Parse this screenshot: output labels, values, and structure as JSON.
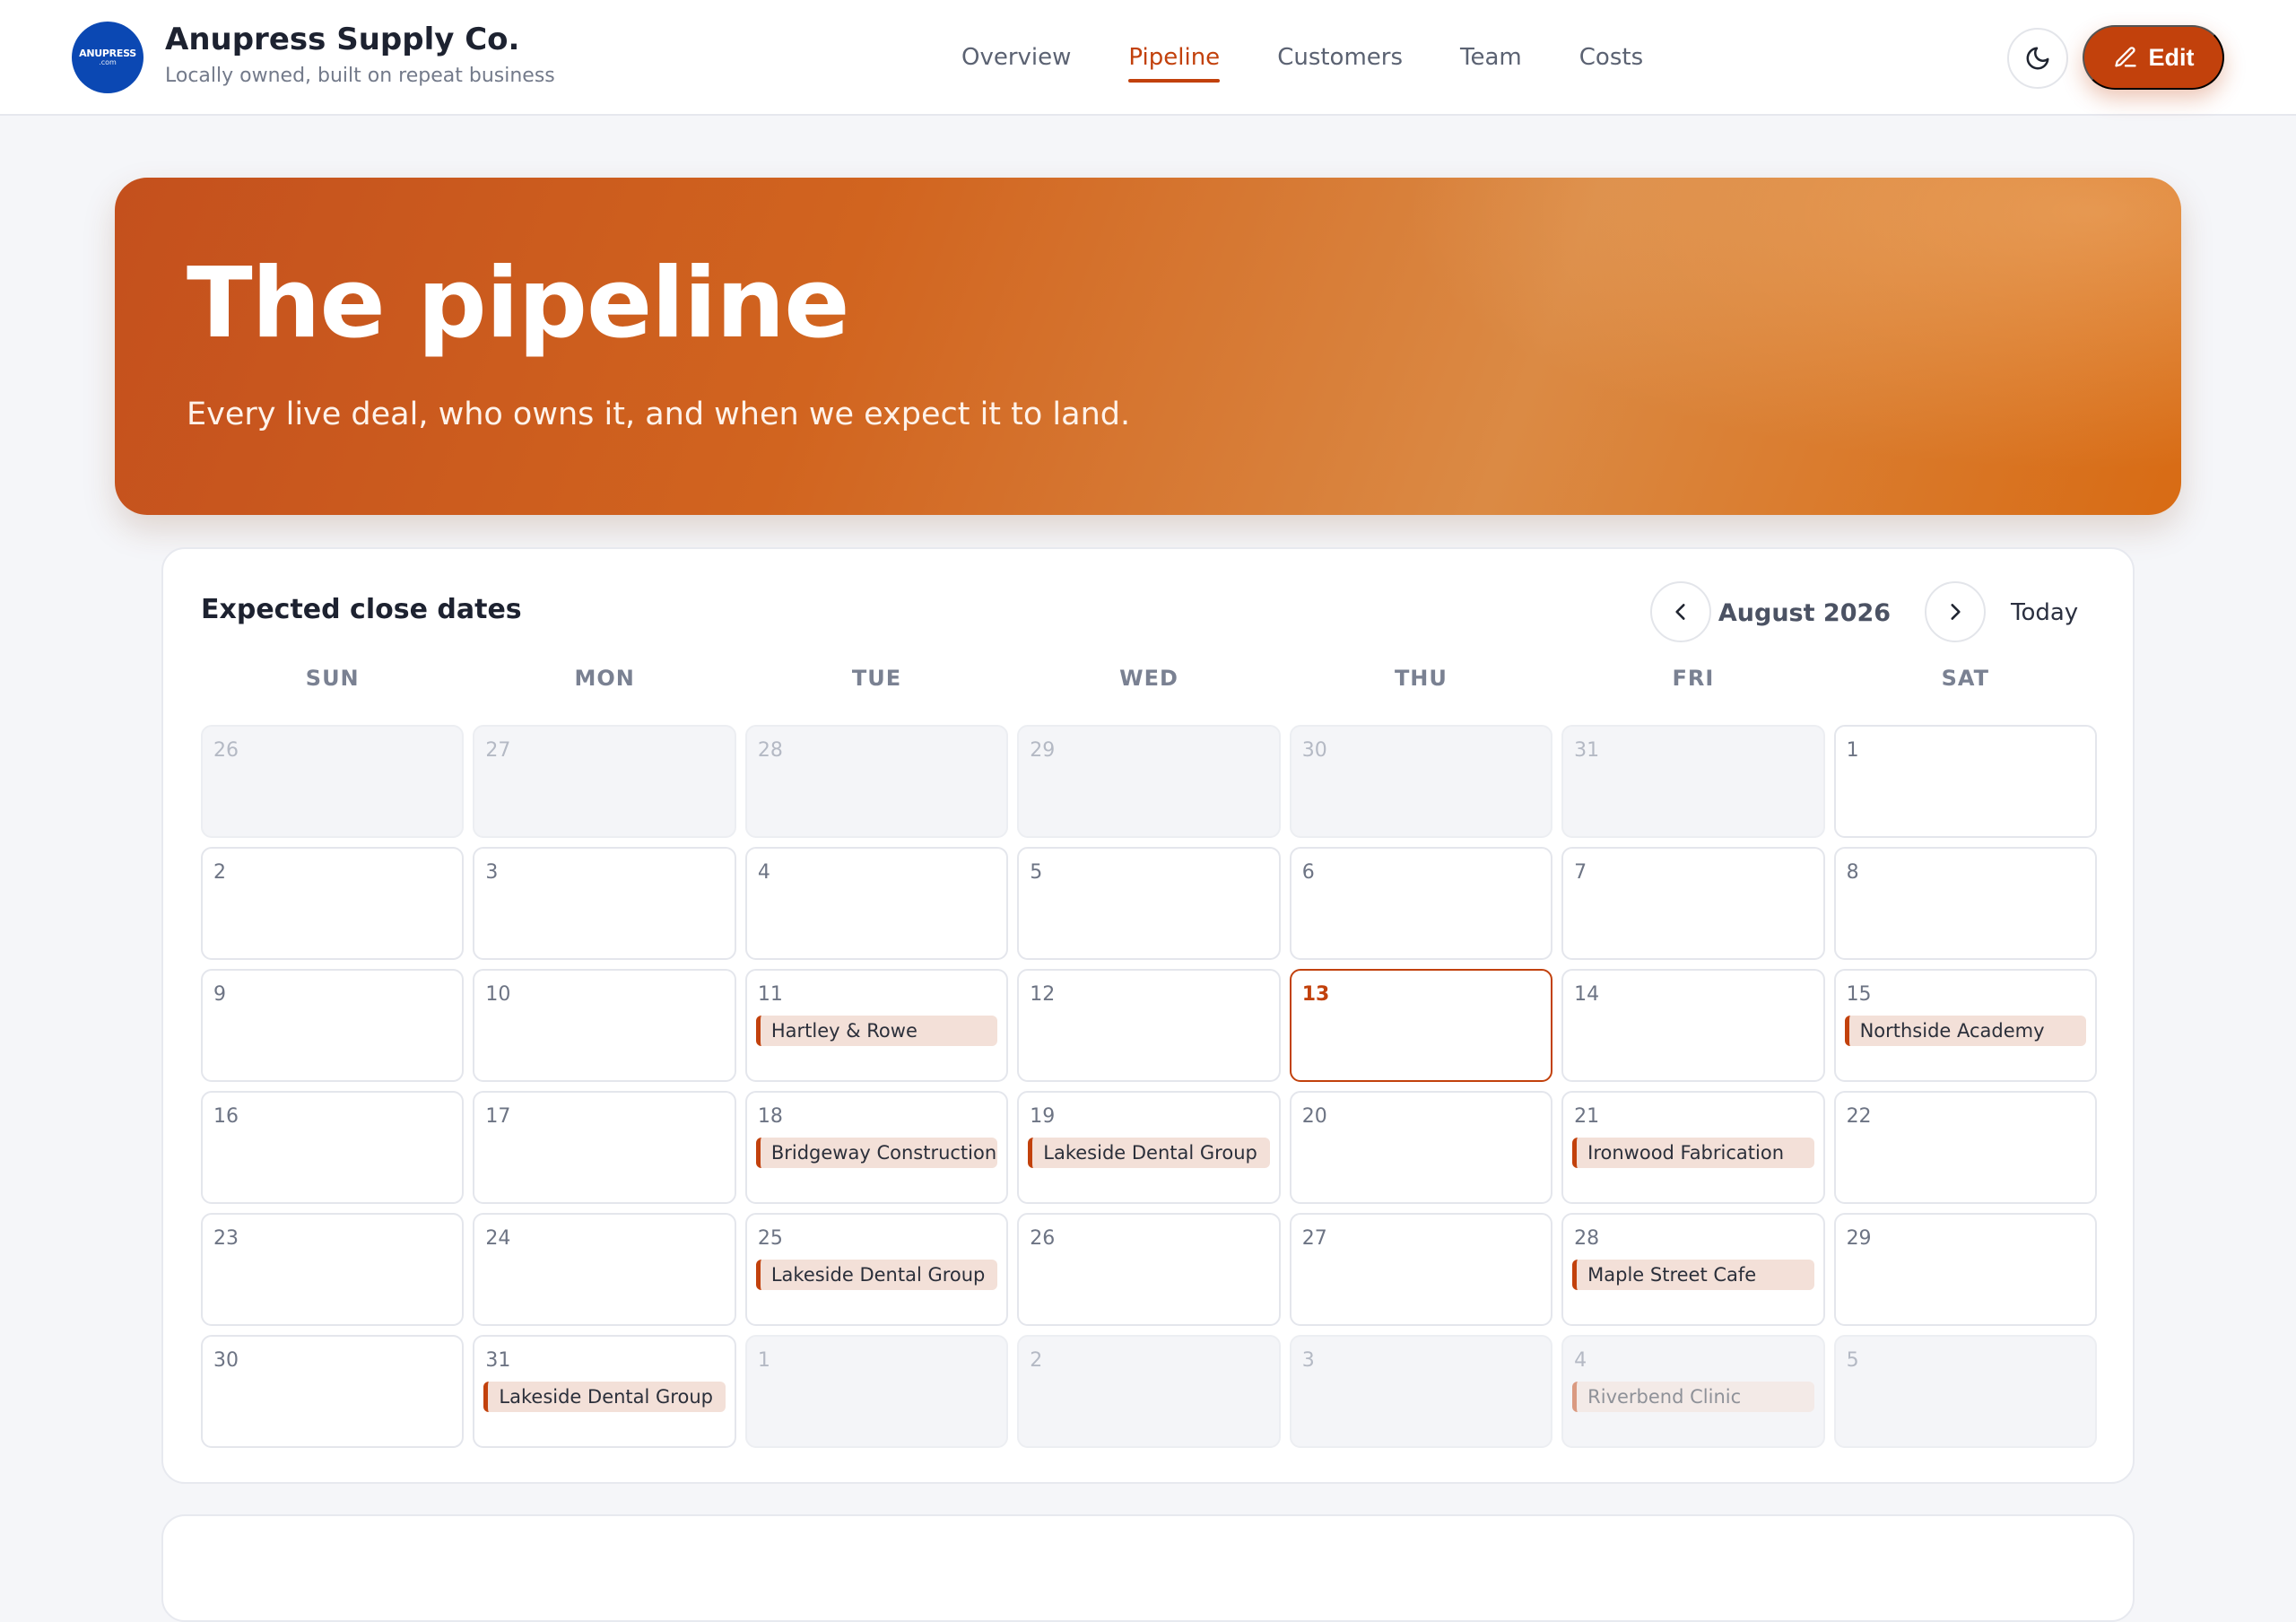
{
  "brand": {
    "logo_text": "ANUPRESS",
    "logo_subtext": ".com",
    "name": "Anupress Supply Co.",
    "tagline": "Locally owned, built on repeat business"
  },
  "nav": {
    "items": [
      {
        "label": "Overview",
        "active": false
      },
      {
        "label": "Pipeline",
        "active": true
      },
      {
        "label": "Customers",
        "active": false
      },
      {
        "label": "Team",
        "active": false
      },
      {
        "label": "Costs",
        "active": false
      }
    ]
  },
  "header_actions": {
    "theme_icon": "moon-icon",
    "edit_label": "Edit",
    "edit_icon": "pencil-icon"
  },
  "hero": {
    "title": "The pipeline",
    "subtitle": "Every live deal, who owns it, and when we expect it to land."
  },
  "calendar": {
    "title": "Expected close dates",
    "month_label": "August 2026",
    "today_label": "Today",
    "prev_icon": "chevron-left-icon",
    "next_icon": "chevron-right-icon",
    "weekdays": [
      "SUN",
      "MON",
      "TUE",
      "WED",
      "THU",
      "FRI",
      "SAT"
    ],
    "days": [
      {
        "day": "26",
        "muted": true
      },
      {
        "day": "27",
        "muted": true
      },
      {
        "day": "28",
        "muted": true
      },
      {
        "day": "29",
        "muted": true
      },
      {
        "day": "30",
        "muted": true
      },
      {
        "day": "31",
        "muted": true
      },
      {
        "day": "1"
      },
      {
        "day": "2"
      },
      {
        "day": "3"
      },
      {
        "day": "4"
      },
      {
        "day": "5"
      },
      {
        "day": "6"
      },
      {
        "day": "7"
      },
      {
        "day": "8"
      },
      {
        "day": "9"
      },
      {
        "day": "10"
      },
      {
        "day": "11",
        "event": "Hartley & Rowe"
      },
      {
        "day": "12"
      },
      {
        "day": "13",
        "today": true
      },
      {
        "day": "14"
      },
      {
        "day": "15",
        "event": "Northside Academy"
      },
      {
        "day": "16"
      },
      {
        "day": "17"
      },
      {
        "day": "18",
        "event": "Bridgeway Construction"
      },
      {
        "day": "19",
        "event": "Lakeside Dental Group"
      },
      {
        "day": "20"
      },
      {
        "day": "21",
        "event": "Ironwood Fabrication"
      },
      {
        "day": "22"
      },
      {
        "day": "23"
      },
      {
        "day": "24"
      },
      {
        "day": "25",
        "event": "Lakeside Dental Group"
      },
      {
        "day": "26"
      },
      {
        "day": "27"
      },
      {
        "day": "28",
        "event": "Maple Street Cafe"
      },
      {
        "day": "29"
      },
      {
        "day": "30"
      },
      {
        "day": "31",
        "event": "Lakeside Dental Group"
      },
      {
        "day": "1",
        "muted": true
      },
      {
        "day": "2",
        "muted": true
      },
      {
        "day": "3",
        "muted": true
      },
      {
        "day": "4",
        "muted": true,
        "event": "Riverbend Clinic"
      },
      {
        "day": "5",
        "muted": true
      }
    ]
  },
  "colors": {
    "accent": "#c2410c",
    "brand_logo": "#0b48b3",
    "event_bg": "#f3e0d8"
  }
}
